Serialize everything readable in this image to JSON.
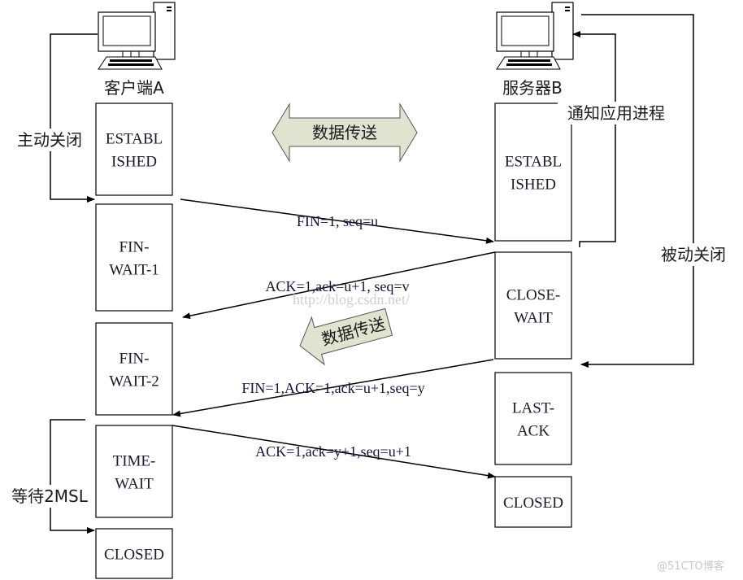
{
  "client": {
    "label": "客户端A",
    "states": [
      "ESTABL|ISHED",
      "FIN-|WAIT-1",
      "FIN-|WAIT-2",
      "TIME-|WAIT",
      "CLOSED"
    ]
  },
  "server": {
    "label": "服务器B",
    "states": [
      "ESTABL|ISHED",
      "CLOSE-|WAIT",
      "LAST-|ACK",
      "CLOSED"
    ]
  },
  "messages": [
    "FIN=1,  seq=u",
    "ACK=1,ack=u+1,  seq=v",
    "FIN=1,ACK=1,ack=u+1,seq=y",
    "ACK=1,ack=y+1,seq=u+1"
  ],
  "annotations": {
    "active_close": "主动关闭",
    "wait_2msl": "等待2MSL",
    "notify_app": "通知应用进程",
    "passive_close": "被动关闭"
  },
  "data_transfer": [
    "数据传送",
    "数据传送"
  ],
  "watermarks": [
    "http://blog.csdn.net/",
    "@51CTO博客"
  ],
  "colors": {
    "arrow_fill": "#dfe3cf",
    "line": "#000000"
  }
}
